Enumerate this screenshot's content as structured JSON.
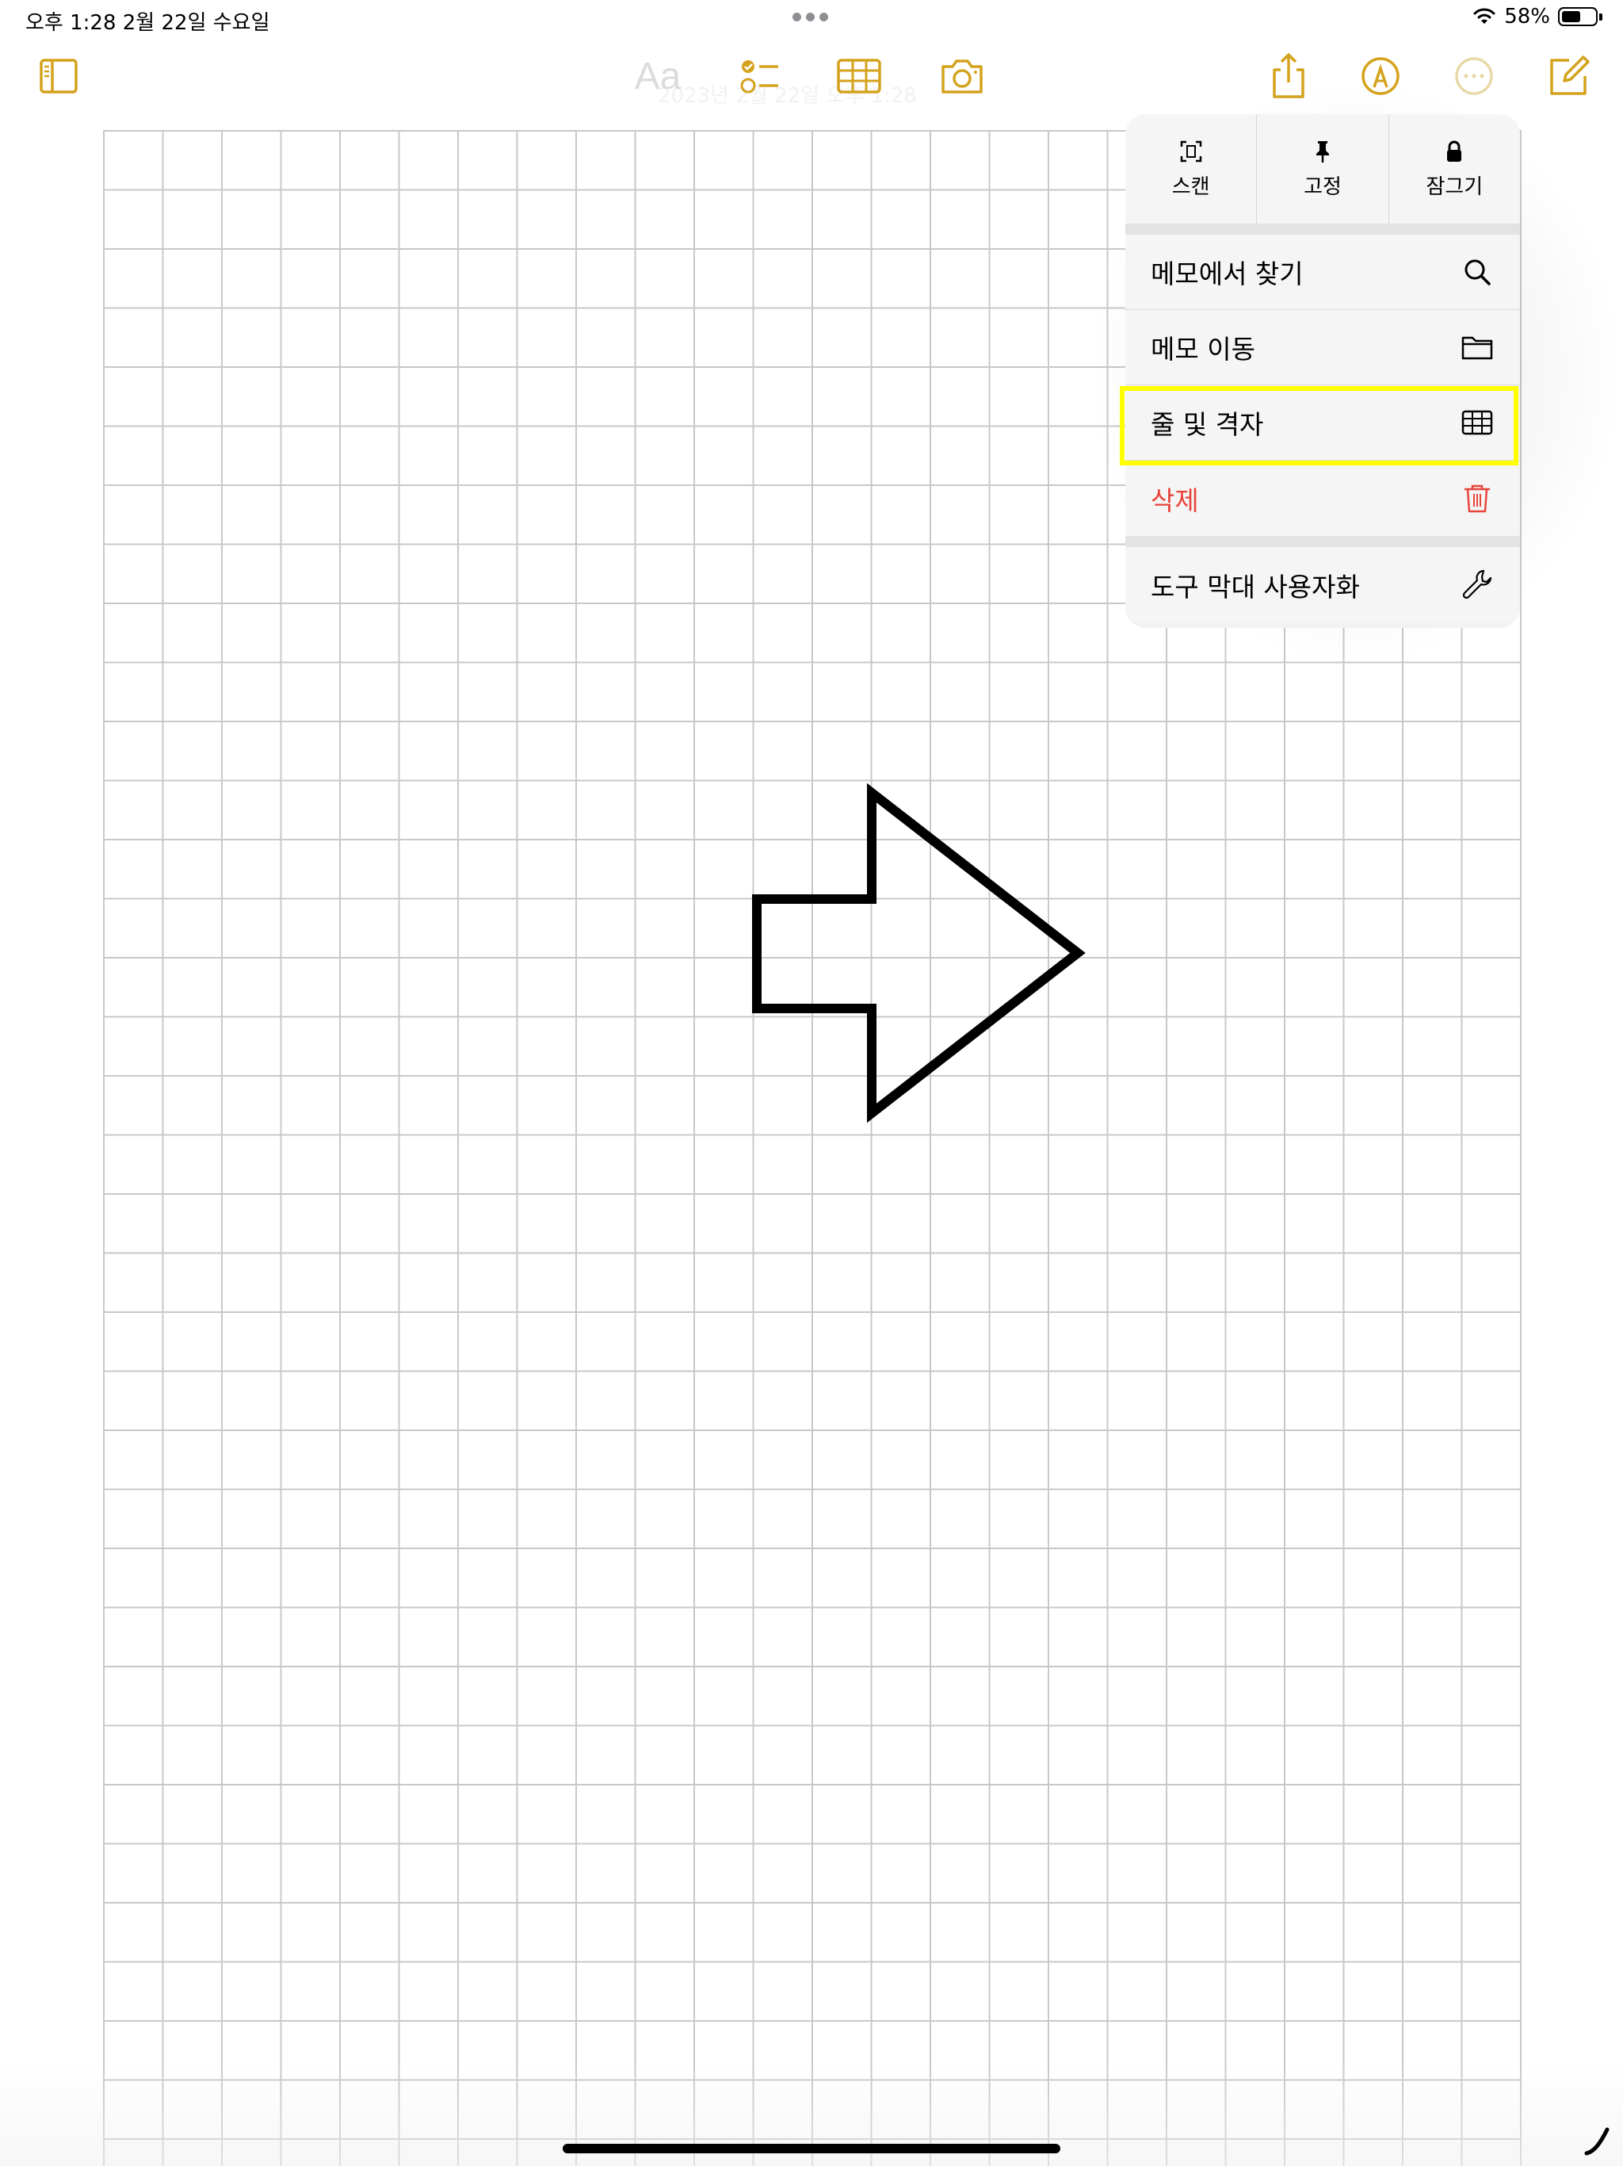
{
  "status_bar": {
    "time_date": "오후 1:28   2월 22일 수요일",
    "battery": "58%",
    "battery_level": 0.58
  },
  "toolbar": {
    "format_label": "Aa",
    "faded_title": "2023년 2월 22일 오후 1:28"
  },
  "menu": {
    "top_actions": [
      {
        "label": "스캔",
        "icon": "scan-icon"
      },
      {
        "label": "고정",
        "icon": "pin-icon"
      },
      {
        "label": "잠그기",
        "icon": "lock-icon"
      }
    ],
    "items": [
      {
        "label": "메모에서 찾기",
        "icon": "search-icon"
      },
      {
        "label": "메모 이동",
        "icon": "folder-icon"
      },
      {
        "label": "줄 및 격자",
        "icon": "grid-icon",
        "highlighted": true
      },
      {
        "label": "삭제",
        "icon": "trash-icon",
        "color": "#e8453c"
      },
      {
        "label": "도구 막대 사용자화",
        "icon": "wrench-icon"
      }
    ]
  },
  "colors": {
    "accent": "#d4a21c",
    "danger": "#e8453c",
    "highlight": "#ffff00",
    "grid_line": "#c8c8c8"
  }
}
